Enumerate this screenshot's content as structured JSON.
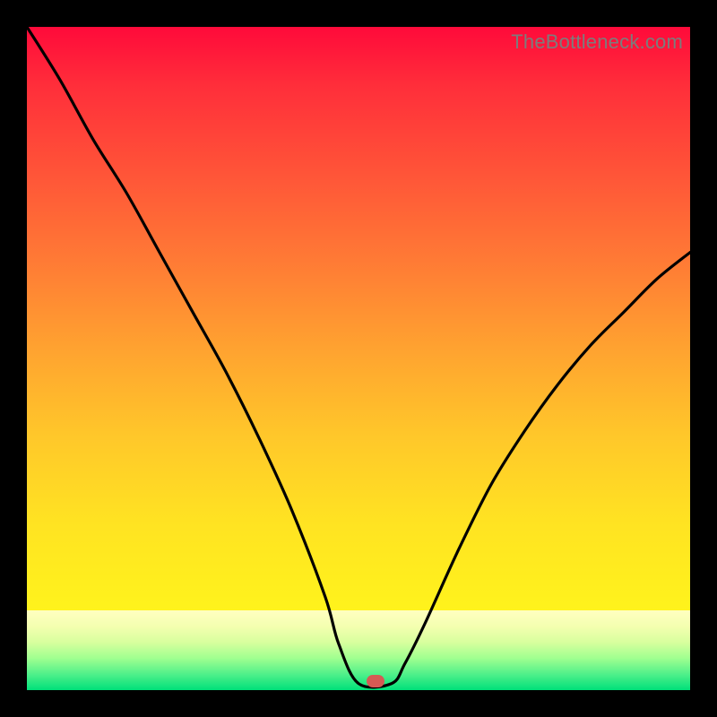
{
  "watermark": "TheBottleneck.com",
  "marker": {
    "x_pct": 52.5,
    "y_bottom_pct": 1.3
  },
  "colors": {
    "frame": "#000000",
    "curve": "#000000",
    "marker": "#d45a54",
    "watermark": "#7c7c7c"
  },
  "chart_data": {
    "type": "line",
    "title": "",
    "xlabel": "",
    "ylabel": "",
    "xlim": [
      0,
      100
    ],
    "ylim": [
      0,
      100
    ],
    "annotations": [
      "TheBottleneck.com"
    ],
    "series": [
      {
        "name": "bottleneck-curve",
        "x": [
          0,
          5,
          10,
          15,
          20,
          25,
          30,
          35,
          40,
          45,
          47,
          50,
          55,
          57,
          60,
          65,
          70,
          75,
          80,
          85,
          90,
          95,
          100
        ],
        "y": [
          100,
          92,
          83,
          75,
          66,
          57,
          48,
          38,
          27,
          14,
          7,
          1,
          1,
          4,
          10,
          21,
          31,
          39,
          46,
          52,
          57,
          62,
          66
        ]
      }
    ],
    "marker_point": {
      "x": 52.5,
      "y": 1.3
    },
    "background_gradient": {
      "orientation": "vertical",
      "stops": [
        {
          "pos": 0.0,
          "color": "#ff0a3a"
        },
        {
          "pos": 0.25,
          "color": "#ff5438"
        },
        {
          "pos": 0.5,
          "color": "#ffa230"
        },
        {
          "pos": 0.75,
          "color": "#ffe322"
        },
        {
          "pos": 0.88,
          "color": "#ffffc0"
        },
        {
          "pos": 0.94,
          "color": "#a0ff90"
        },
        {
          "pos": 1.0,
          "color": "#00e07a"
        }
      ]
    }
  }
}
